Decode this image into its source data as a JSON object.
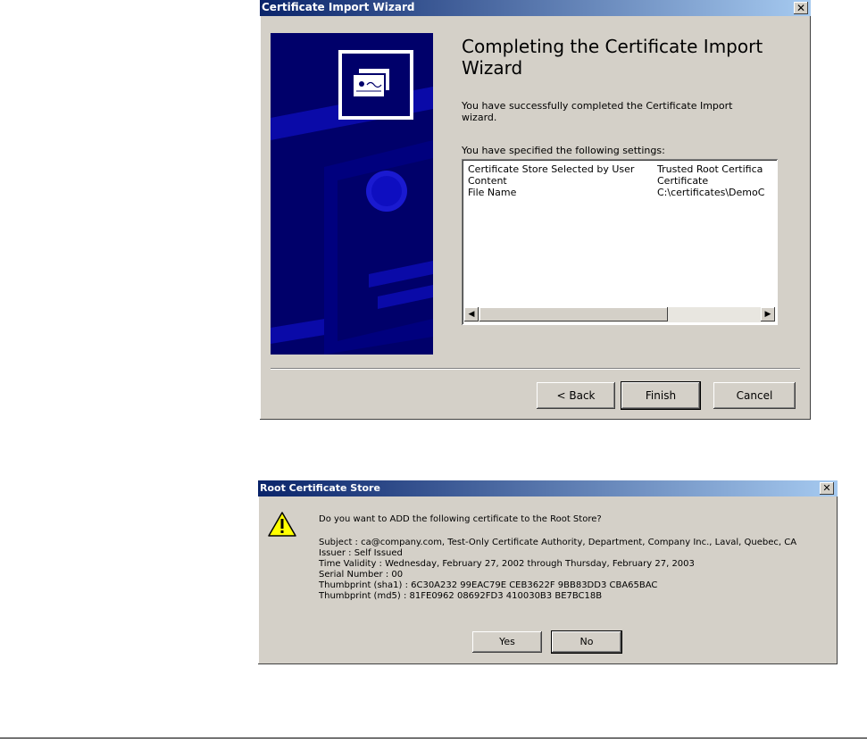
{
  "wizard": {
    "title": "Certificate Import Wizard",
    "heading": "Completing the Certificate Import Wizard",
    "success_text": "You have successfully completed the Certificate Import wizard.",
    "settings_label": "You have specified the following settings:",
    "settings": [
      {
        "name": "Certificate Store Selected by User",
        "value": "Trusted Root Certifica"
      },
      {
        "name": "Content",
        "value": "Certificate"
      },
      {
        "name": "File Name",
        "value": "C:\\certificates\\DemoC"
      }
    ],
    "buttons": {
      "back": "< Back",
      "finish": "Finish",
      "cancel": "Cancel"
    },
    "close_glyph": "✕"
  },
  "dialog": {
    "title": "Root Certificate Store",
    "question": "Do you want to ADD the following certificate to the Root Store?",
    "details": {
      "subject": "Subject : ca@company.com, Test-Only Certificate Authority, Department, Company Inc., Laval, Quebec, CA",
      "issuer": "Issuer : Self Issued",
      "validity": "Time Validity : Wednesday, February 27, 2002 through Thursday, February 27, 2003",
      "serial": "Serial Number : 00",
      "sha1": "Thumbprint (sha1) : 6C30A232 99EAC79E CEB3622F 9BB83DD3 CBA65BAC",
      "md5": "Thumbprint (md5) : 81FE0962 08692FD3 410030B3 BE7BC18B"
    },
    "buttons": {
      "yes": "Yes",
      "no": "No"
    },
    "close_glyph": "✕"
  },
  "colors": {
    "title_start": "#0a246a",
    "title_end": "#a6caf0",
    "face": "#d4d0c8",
    "art_bg": "#00006a"
  }
}
